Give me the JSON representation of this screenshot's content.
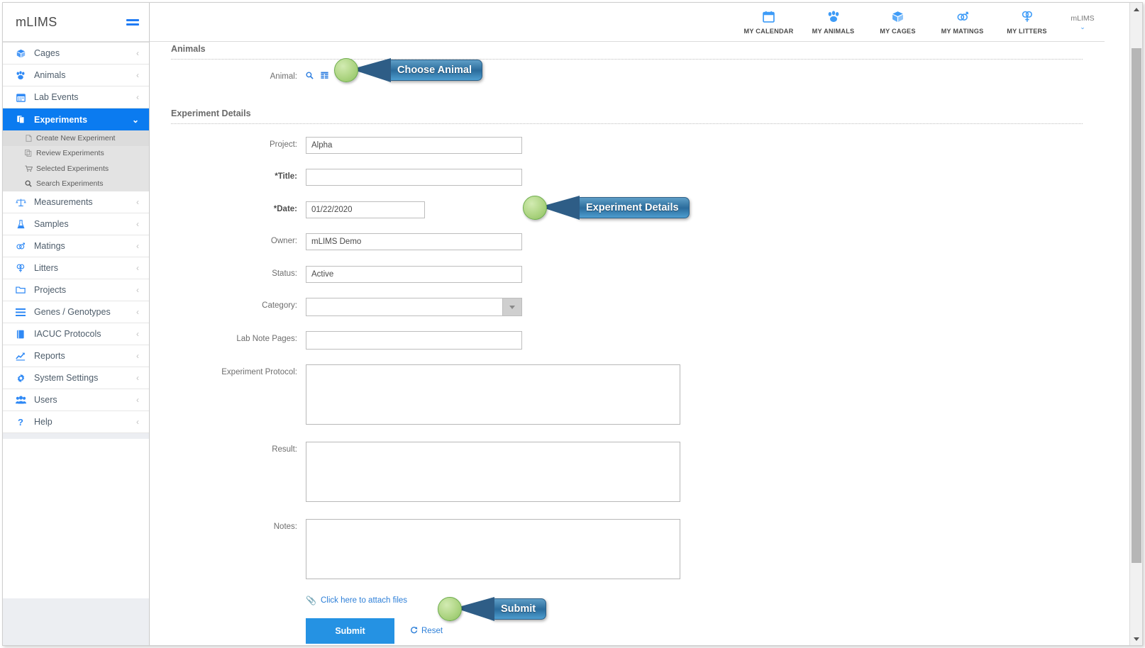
{
  "brand": {
    "name": "mLIMS",
    "menu_icon": "hamburger-icon"
  },
  "sidebar": {
    "items": [
      {
        "label": "Cages",
        "icon": "cube-icon",
        "chevron": "‹"
      },
      {
        "label": "Animals",
        "icon": "paw-icon",
        "chevron": "‹"
      },
      {
        "label": "Lab Events",
        "icon": "calendar-icon",
        "chevron": "‹"
      },
      {
        "label": "Experiments",
        "icon": "documents-icon",
        "chevron": "⌄",
        "active": true
      },
      {
        "label": "Measurements",
        "icon": "scales-icon",
        "chevron": "‹"
      },
      {
        "label": "Samples",
        "icon": "flask-icon",
        "chevron": "‹"
      },
      {
        "label": "Matings",
        "icon": "mating-icon",
        "chevron": "‹"
      },
      {
        "label": "Litters",
        "icon": "litters-icon",
        "chevron": "‹"
      },
      {
        "label": "Projects",
        "icon": "folder-icon",
        "chevron": "‹"
      },
      {
        "label": "Genes / Genotypes",
        "icon": "list-icon",
        "chevron": "‹"
      },
      {
        "label": "IACUC Protocols",
        "icon": "book-icon",
        "chevron": "‹"
      },
      {
        "label": "Reports",
        "icon": "chart-icon",
        "chevron": "‹"
      },
      {
        "label": "System Settings",
        "icon": "gear-icon",
        "chevron": "‹"
      },
      {
        "label": "Users",
        "icon": "users-icon",
        "chevron": "‹"
      },
      {
        "label": "Help",
        "icon": "question-icon",
        "chevron": "‹"
      }
    ],
    "submenu": [
      {
        "label": "Create New Experiment",
        "icon": "file-icon",
        "selected": true
      },
      {
        "label": "Review Experiments",
        "icon": "copy-icon",
        "selected": false
      },
      {
        "label": "Selected Experiments",
        "icon": "cart-icon",
        "selected": false
      },
      {
        "label": "Search Experiments",
        "icon": "search-icon",
        "selected": false
      }
    ]
  },
  "topnav": {
    "items": [
      {
        "label": "MY CALENDAR",
        "icon": "calendar-icon"
      },
      {
        "label": "MY ANIMALS",
        "icon": "paw-icon"
      },
      {
        "label": "MY CAGES",
        "icon": "cube-icon"
      },
      {
        "label": "MY MATINGS",
        "icon": "mating-icon"
      },
      {
        "label": "MY LITTERS",
        "icon": "litters-icon"
      }
    ],
    "user": {
      "name": "mLIMS",
      "chevron": "⌄"
    }
  },
  "main": {
    "animals_section": {
      "heading": "Animals",
      "animal_label": "Animal:",
      "search_icon": "search-icon",
      "grid_icon": "grid-icon"
    },
    "details_section": {
      "heading": "Experiment Details",
      "fields": {
        "project": {
          "label": "Project:",
          "value": "Alpha"
        },
        "title": {
          "label": "*Title:",
          "value": ""
        },
        "date": {
          "label": "*Date:",
          "value": "01/22/2020"
        },
        "owner": {
          "label": "Owner:",
          "value": "mLIMS Demo"
        },
        "status": {
          "label": "Status:",
          "value": "Active"
        },
        "category": {
          "label": "Category:",
          "value": ""
        },
        "lab_note_pages": {
          "label": "Lab Note Pages:",
          "value": ""
        },
        "experiment_protocol": {
          "label": "Experiment Protocol:",
          "value": ""
        },
        "result": {
          "label": "Result:",
          "value": ""
        },
        "notes": {
          "label": "Notes:",
          "value": ""
        }
      }
    },
    "attach_link": "Click here to attach files",
    "submit_label": "Submit",
    "reset_label": "Reset"
  },
  "callouts": [
    {
      "text": "Choose Animal"
    },
    {
      "text": "Experiment Details"
    },
    {
      "text": "Submit"
    }
  ],
  "colors": {
    "accent": "#0b7bf0",
    "icon_blue": "#2f89f5",
    "submit_blue": "#2592e3",
    "callout_blue": "#2e6f9e",
    "callout_green": "#aed583"
  }
}
